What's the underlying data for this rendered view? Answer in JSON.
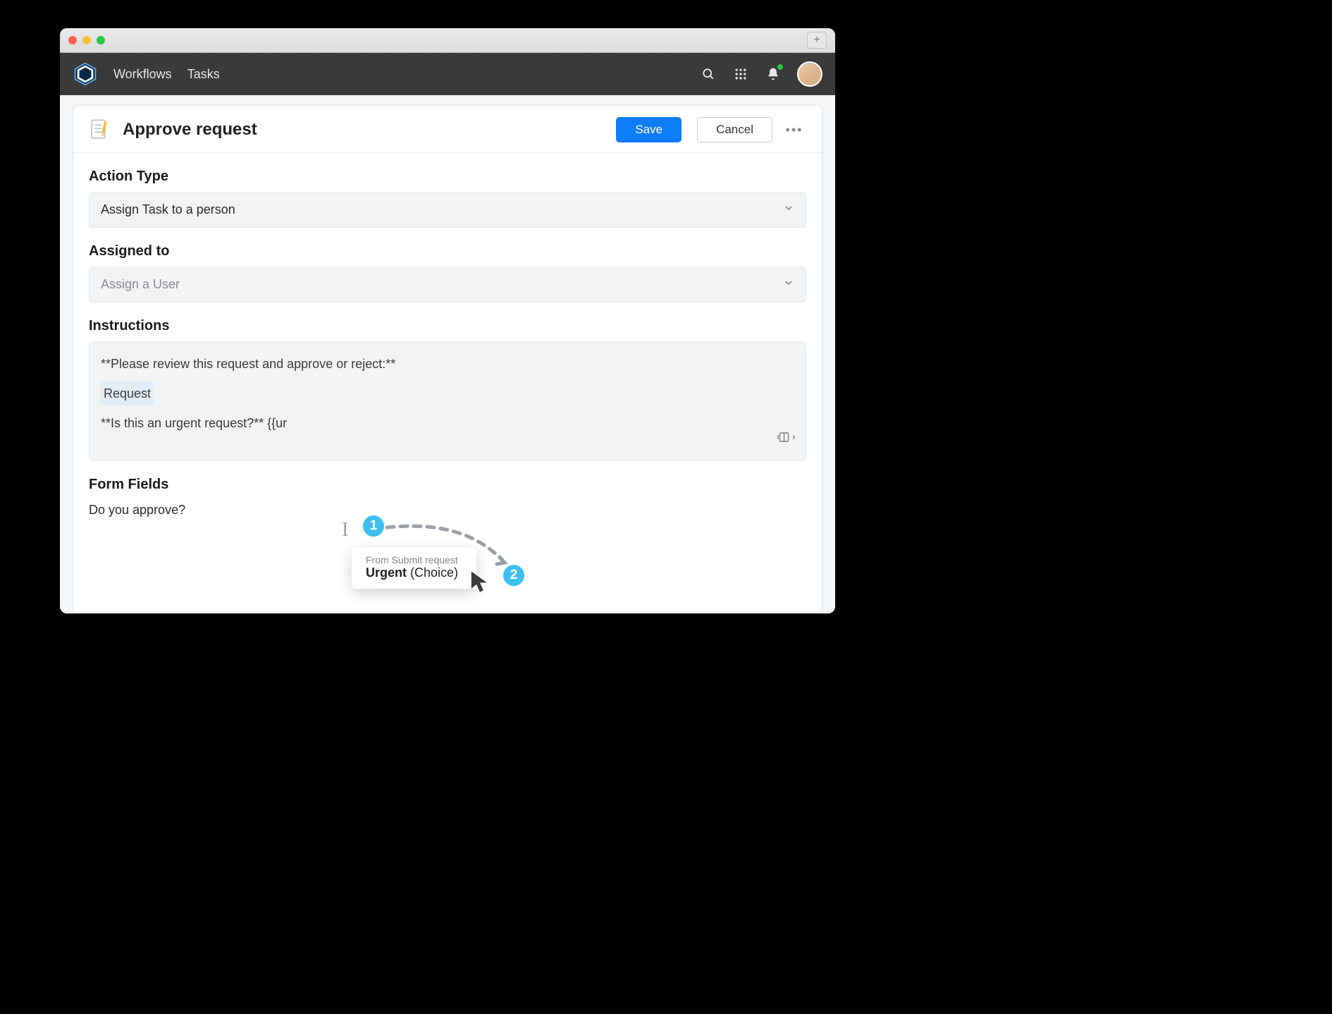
{
  "nav": {
    "link1": "Workflows",
    "link2": "Tasks"
  },
  "header": {
    "title": "Approve request",
    "save": "Save",
    "cancel": "Cancel"
  },
  "fields": {
    "action_type_label": "Action Type",
    "action_type_value": "Assign Task to a person",
    "assigned_to_label": "Assigned to",
    "assigned_to_placeholder": "Assign a User",
    "instructions_label": "Instructions",
    "instructions_line1": "**Please review this request and approve or reject:**",
    "instructions_line2": "Request",
    "instructions_line3_pre": "**Is this an urgent request?** {{ur",
    "form_fields_label": "Form Fields",
    "form_field_row1": "Do you approve?"
  },
  "suggestion": {
    "source": "From Submit request",
    "name": "Urgent",
    "type": " (Choice)"
  },
  "steps": {
    "one": "1",
    "two": "2"
  }
}
